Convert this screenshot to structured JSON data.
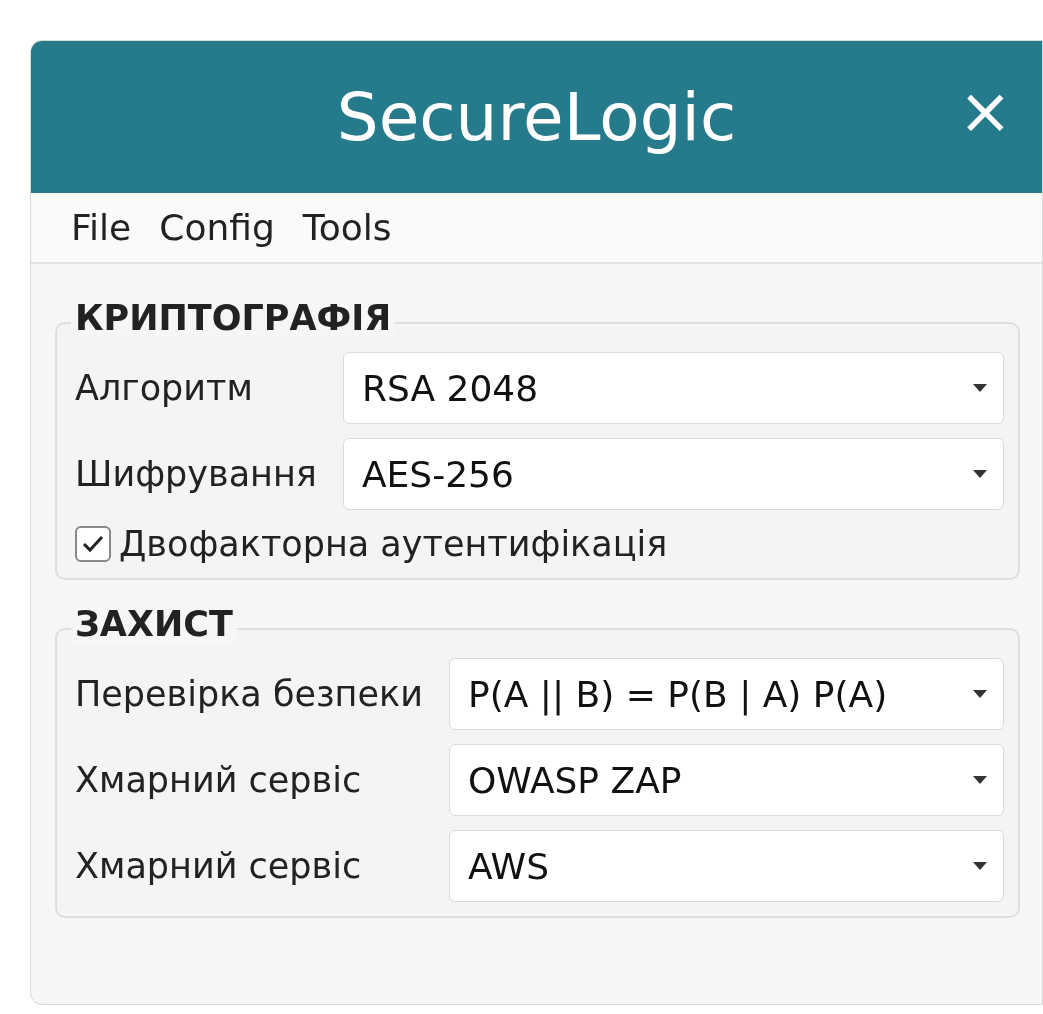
{
  "window": {
    "title": "SecureLogic",
    "close": "×"
  },
  "menu": [
    {
      "label": "File"
    },
    {
      "label": "Config"
    },
    {
      "label": "Tools"
    }
  ],
  "groups": [
    {
      "title": "КРИПТОГРАФІЯ",
      "rows": [
        {
          "kind": "combo",
          "label": "Алгоритм",
          "value": "RSA 2048"
        },
        {
          "kind": "combo",
          "label": "Шифрування",
          "value": "AES-256"
        },
        {
          "kind": "checkbox",
          "label": "Двофакторна аутентифікація",
          "checked": true
        }
      ]
    },
    {
      "title": "ЗАХИСТ",
      "rows": [
        {
          "kind": "combo",
          "label": "Перевірка безпеки",
          "value": "P(A || B) = P(B | A) P(A)"
        },
        {
          "kind": "combo",
          "label": "Хмарний сервіс",
          "value": "OWASP ZAP"
        },
        {
          "kind": "combo",
          "label": "Хмарний сервіс",
          "value": "AWS"
        }
      ]
    }
  ]
}
